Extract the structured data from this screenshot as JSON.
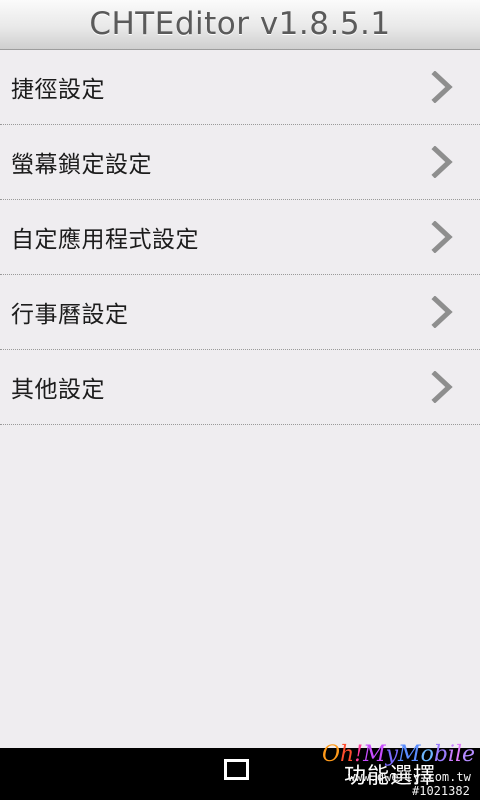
{
  "app": {
    "title": "CHTEditor v1.8.5.1"
  },
  "menu": {
    "items": [
      {
        "label": "捷徑設定"
      },
      {
        "label": "螢幕鎖定設定"
      },
      {
        "label": "自定應用程式設定"
      },
      {
        "label": "行事曆設定"
      },
      {
        "label": "其他設定"
      }
    ]
  },
  "navbar": {
    "menu_label": "功能選擇",
    "home_icon": "square-icon"
  },
  "watermark": {
    "logo_text": "Oh!MyMobile",
    "site": "www.qwerty.com.tw",
    "id": "#1021382"
  },
  "colors": {
    "background": "#efedf0",
    "title_text": "#5a5a5a",
    "item_text": "#1c1c1c",
    "chevron": "#8e8e8e",
    "navbar": "#000000"
  }
}
